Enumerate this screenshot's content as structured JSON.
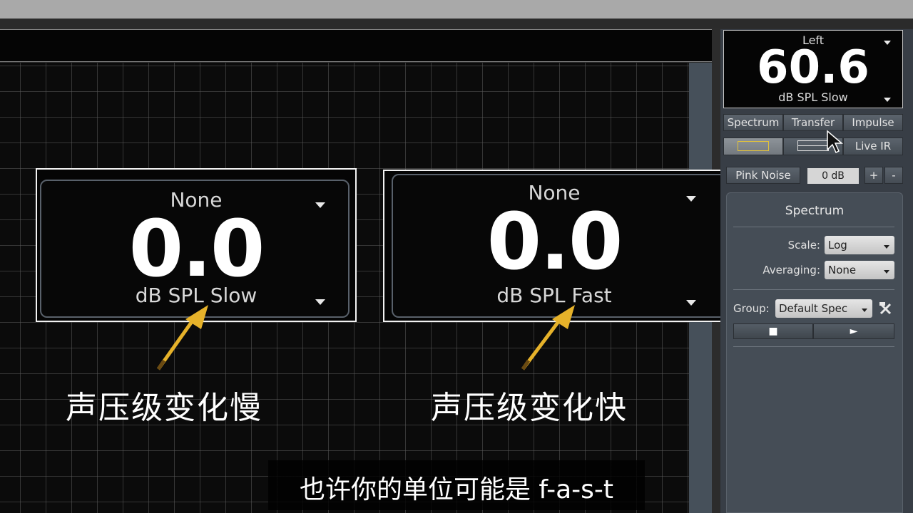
{
  "plot": {
    "meter_slow": {
      "top_label": "None",
      "value": "0.0",
      "unit": "dB SPL Slow"
    },
    "meter_fast": {
      "top_label": "None",
      "value": "0.0",
      "unit": "dB SPL Fast"
    }
  },
  "annotations": {
    "slow_caption": "声压级变化慢",
    "fast_caption": "声压级变化快",
    "arrow_color": "#e6b22a"
  },
  "subtitle": "也许你的单位可能是 f-a-s-t",
  "readout": {
    "channel": "Left",
    "value": "60.6",
    "unit": "dB SPL Slow"
  },
  "mode_tabs": [
    "Spectrum",
    "Transfer",
    "Impulse"
  ],
  "view_buttons": {
    "single_icon": "single-pane-icon",
    "split_icon": "split-pane-icon",
    "live_ir": "Live IR"
  },
  "generator": {
    "label": "Pink Noise",
    "level": "0 dB",
    "plus": "+",
    "minus": "-"
  },
  "spectrum_panel": {
    "title": "Spectrum",
    "scale_label": "Scale:",
    "scale_value": "Log",
    "averaging_label": "Averaging:",
    "averaging_value": "None",
    "group_label": "Group:",
    "group_value": "Default Spec",
    "tools_icon": "tools-icon",
    "stop_icon": "■",
    "play_icon": "►"
  },
  "colors": {
    "accent_yellow": "#e6b22a",
    "panel": "#383e46"
  }
}
